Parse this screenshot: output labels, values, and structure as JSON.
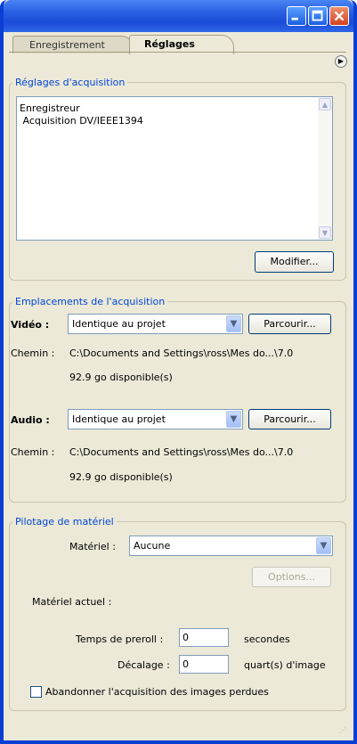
{
  "window": {
    "minimize_icon": "minimize-icon",
    "maximize_icon": "maximize-icon",
    "close_icon": "close-icon"
  },
  "tabs": [
    {
      "label": "Enregistrement"
    },
    {
      "label": "Réglages"
    }
  ],
  "acquisition_settings": {
    "legend": "Réglages d'acquisition",
    "lines": [
      "Enregistreur",
      " Acquisition DV/IEEE1394"
    ],
    "modify_button": "Modifier..."
  },
  "acquisition_locations": {
    "legend": "Emplacements de l'acquisition",
    "video": {
      "label": "Vidéo :",
      "select_value": "Identique au projet",
      "browse_button": "Parcourir...",
      "path_label": "Chemin :",
      "path": "C:\\Documents and Settings\\ross\\Mes do...\\7.0",
      "available": "92.9 go disponible(s)"
    },
    "audio": {
      "label": "Audio :",
      "select_value": "Identique au projet",
      "browse_button": "Parcourir...",
      "path_label": "Chemin :",
      "path": "C:\\Documents and Settings\\ross\\Mes do...\\7.0",
      "available": "92.9 go disponible(s)"
    }
  },
  "device_control": {
    "legend": "Pilotage de matériel",
    "device_label": "Matériel :",
    "device_value": "Aucune",
    "options_button": "Options...",
    "current_device_label": "Matériel actuel :",
    "preroll_label": "Temps de preroll :",
    "preroll_value": "0",
    "preroll_unit": "secondes",
    "offset_label": "Décalage :",
    "offset_value": "0",
    "offset_unit": "quart(s) d'image",
    "abort_checkbox_label": "Abandonner l'acquisition des images perdues",
    "abort_checked": false
  }
}
